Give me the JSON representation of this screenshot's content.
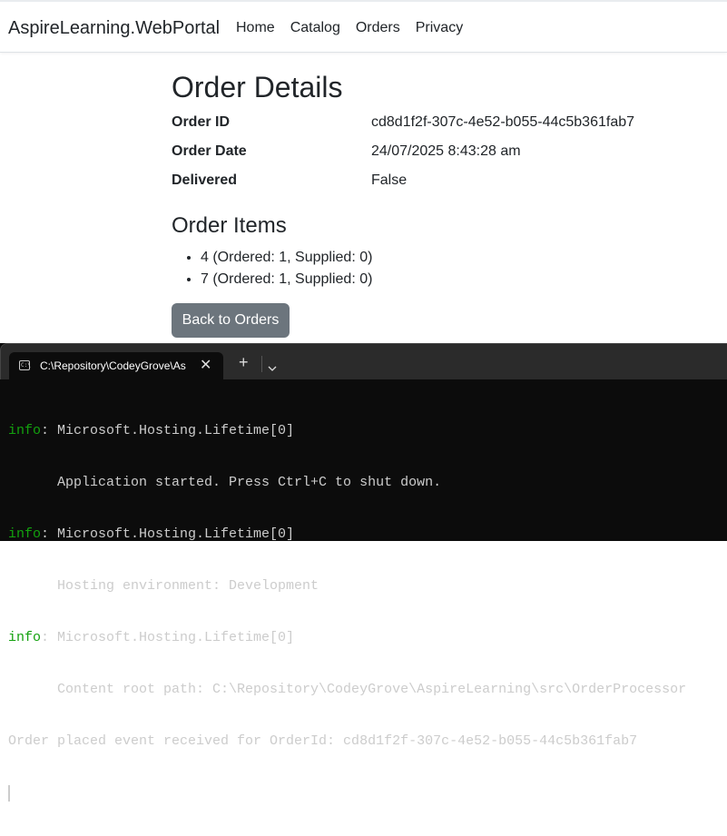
{
  "navbar": {
    "brand": "AspireLearning.WebPortal",
    "links": [
      {
        "label": "Home"
      },
      {
        "label": "Catalog"
      },
      {
        "label": "Orders"
      },
      {
        "label": "Privacy"
      }
    ]
  },
  "order": {
    "title": "Order Details",
    "details": [
      {
        "label": "Order ID",
        "value": "cd8d1f2f-307c-4e52-b055-44c5b361fab7"
      },
      {
        "label": "Order Date",
        "value": "24/07/2025 8:43:28 am"
      },
      {
        "label": "Delivered",
        "value": "False"
      }
    ],
    "items_title": "Order Items",
    "items": [
      "4 (Ordered: 1, Supplied: 0)",
      "7 (Ordered: 1, Supplied: 0)"
    ],
    "back_label": "Back to Orders"
  },
  "terminal": {
    "tab_title": "C:\\Repository\\CodeyGrove\\As",
    "tab_close": "✕",
    "new_tab": "+",
    "tab_icon": "C:\\",
    "lines": [
      {
        "level": "info",
        "text": ": Microsoft.Hosting.Lifetime[0]"
      },
      {
        "level": "",
        "text": "      Application started. Press Ctrl+C to shut down."
      },
      {
        "level": "info",
        "text": ": Microsoft.Hosting.Lifetime[0]"
      },
      {
        "level": "",
        "text": "      Hosting environment: Development"
      },
      {
        "level": "info",
        "text": ": Microsoft.Hosting.Lifetime[0]"
      },
      {
        "level": "",
        "text": "      Content root path: C:\\Repository\\CodeyGrove\\AspireLearning\\src\\OrderProcessor"
      },
      {
        "level": "",
        "text": "Order placed event received for OrderId: cd8d1f2f-307c-4e52-b055-44c5b361fab7"
      }
    ]
  },
  "colors": {
    "log_info": "#13a10e",
    "button_secondary": "#6c757d",
    "terminal_bg": "#0c0c0c"
  }
}
